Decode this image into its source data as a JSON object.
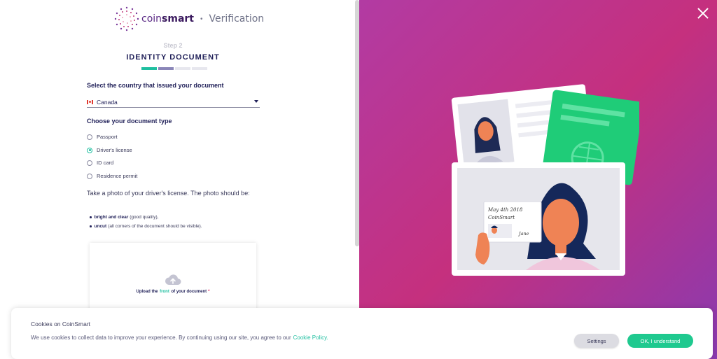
{
  "brand": {
    "name_light": "coin",
    "name_bold": "smart",
    "separator": "•",
    "subtitle": "Verification"
  },
  "step": {
    "label": "Step 2",
    "title": "IDENTITY DOCUMENT",
    "progress": {
      "completed": 2,
      "total": 4
    }
  },
  "country": {
    "heading": "Select the country that issued your document",
    "selected": "Canada"
  },
  "doc_type": {
    "heading": "Choose your document type",
    "options": [
      {
        "label": "Passport",
        "checked": false
      },
      {
        "label": "Driver's license",
        "checked": true
      },
      {
        "label": "ID card",
        "checked": false
      },
      {
        "label": "Residence permit",
        "checked": false
      }
    ]
  },
  "instructions": {
    "text": "Take a photo of your driver's license. The photo should be:",
    "bullets": [
      {
        "bold": "bright and clear",
        "rest": "(good quality),"
      },
      {
        "bold": "uncut",
        "rest": "(all corners of the document should be visible)."
      }
    ]
  },
  "upload": {
    "prefix": "Upload the",
    "highlight": "front",
    "suffix": "of your document",
    "required_mark": "*"
  },
  "illustration": {
    "card_date": "May 4th 2018",
    "card_brand": "CoinSmart",
    "card_signature": "Jane"
  },
  "cookie": {
    "title": "Cookies on CoinSmart",
    "text": "We use cookies to collect data to improve your experience. By continuing using our site, you agree to our",
    "link": "Cookie Policy.",
    "settings_label": "Settings",
    "ok_label": "OK, I understand"
  },
  "colors": {
    "accent": "#1fbfa0",
    "brand": "#5b2a86",
    "ok_button": "#1fc98f",
    "gradient_start": "#b23ba3",
    "gradient_end": "#8a3ab0"
  }
}
